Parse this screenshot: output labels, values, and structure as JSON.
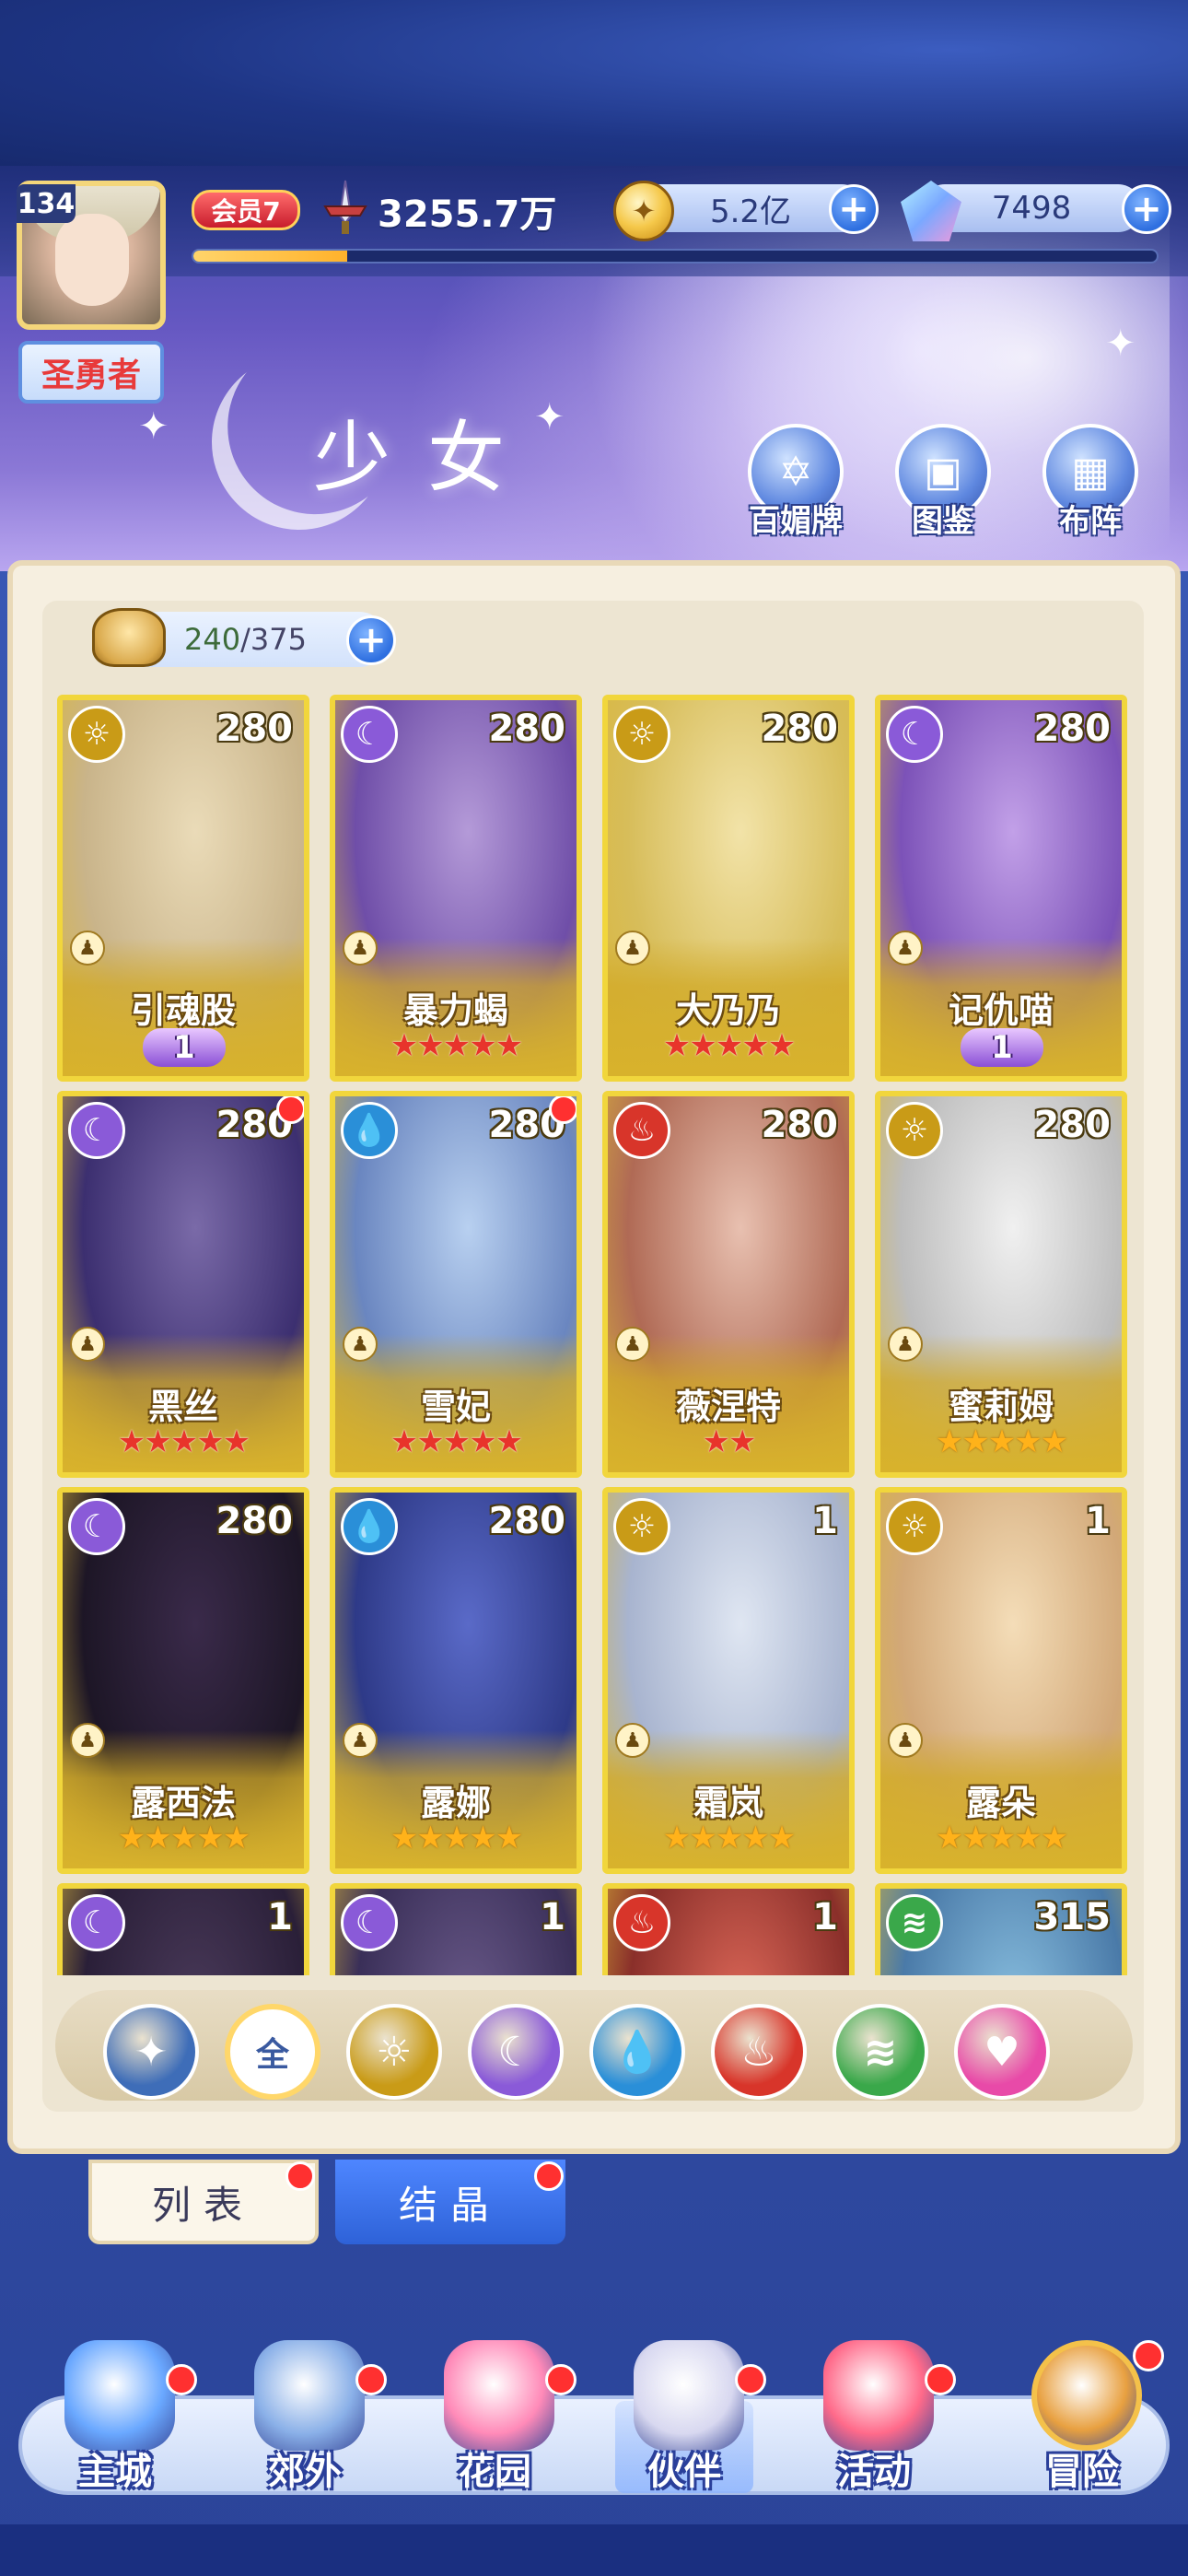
{
  "player": {
    "level": "134",
    "title": "圣勇者",
    "vip": "会员7",
    "power": "3255.7万",
    "exp_progress": 0.16
  },
  "resources": {
    "gold": "5.2亿",
    "gems": "7498"
  },
  "banner": {
    "title": "少女",
    "buttons": [
      "百媚牌",
      "图鉴",
      "布阵"
    ]
  },
  "roster": {
    "owned": "240",
    "capacity": "375"
  },
  "cards": [
    {
      "name": "引魂股",
      "level": "280",
      "element": "light",
      "stars": 0,
      "star_color": "",
      "wing": "1",
      "new": false
    },
    {
      "name": "暴力蝎",
      "level": "280",
      "element": "moon",
      "stars": 5,
      "star_color": "red",
      "wing": "",
      "new": false
    },
    {
      "name": "大乃乃",
      "level": "280",
      "element": "light",
      "stars": 5,
      "star_color": "red",
      "wing": "",
      "new": false
    },
    {
      "name": "记仇喵",
      "level": "280",
      "element": "moon",
      "stars": 0,
      "star_color": "",
      "wing": "1",
      "new": false
    },
    {
      "name": "黑丝",
      "level": "280",
      "element": "moon",
      "stars": 5,
      "star_color": "red",
      "wing": "",
      "new": true
    },
    {
      "name": "雪妃",
      "level": "280",
      "element": "water",
      "stars": 5,
      "star_color": "red",
      "wing": "",
      "new": true
    },
    {
      "name": "薇涅特",
      "level": "280",
      "element": "fire",
      "stars": 2,
      "star_color": "red",
      "wing": "",
      "new": false
    },
    {
      "name": "蜜莉姆",
      "level": "280",
      "element": "light",
      "stars": 5,
      "star_color": "gold",
      "wing": "",
      "new": false
    },
    {
      "name": "露西法",
      "level": "280",
      "element": "moon",
      "stars": 5,
      "star_color": "gold",
      "wing": "",
      "new": false
    },
    {
      "name": "露娜",
      "level": "280",
      "element": "water",
      "stars": 5,
      "star_color": "gold",
      "wing": "",
      "new": false
    },
    {
      "name": "霜岚",
      "level": "1",
      "element": "light",
      "stars": 5,
      "star_color": "gold",
      "wing": "",
      "new": false
    },
    {
      "name": "露朵",
      "level": "1",
      "element": "light",
      "stars": 5,
      "star_color": "gold",
      "wing": "",
      "new": false
    },
    {
      "name": "",
      "level": "1",
      "element": "moon",
      "stars": 0,
      "star_color": "",
      "wing": "",
      "new": false
    },
    {
      "name": "",
      "level": "1",
      "element": "moon",
      "stars": 0,
      "star_color": "",
      "wing": "",
      "new": false
    },
    {
      "name": "",
      "level": "1",
      "element": "fire",
      "stars": 0,
      "star_color": "",
      "wing": "",
      "new": false
    },
    {
      "name": "",
      "level": "315",
      "element": "wind",
      "stars": 0,
      "star_color": "",
      "wing": "",
      "new": false
    }
  ],
  "filters": {
    "all_label": "全",
    "items": [
      "star",
      "all",
      "light",
      "moon",
      "water",
      "fire",
      "wind",
      "heart"
    ],
    "selected": "all"
  },
  "tabs": {
    "list": "列表",
    "crystal": "结晶"
  },
  "nav": [
    "主城",
    "郊外",
    "花园",
    "伙伴",
    "活动",
    "冒险"
  ],
  "colors": {
    "light": "#c99b17",
    "moon": "#8a5ad8",
    "water": "#2a8fd8",
    "fire": "#d8352a",
    "wind": "#3aa84a",
    "heart": "#e84aa8",
    "star": "#3e6db8"
  }
}
